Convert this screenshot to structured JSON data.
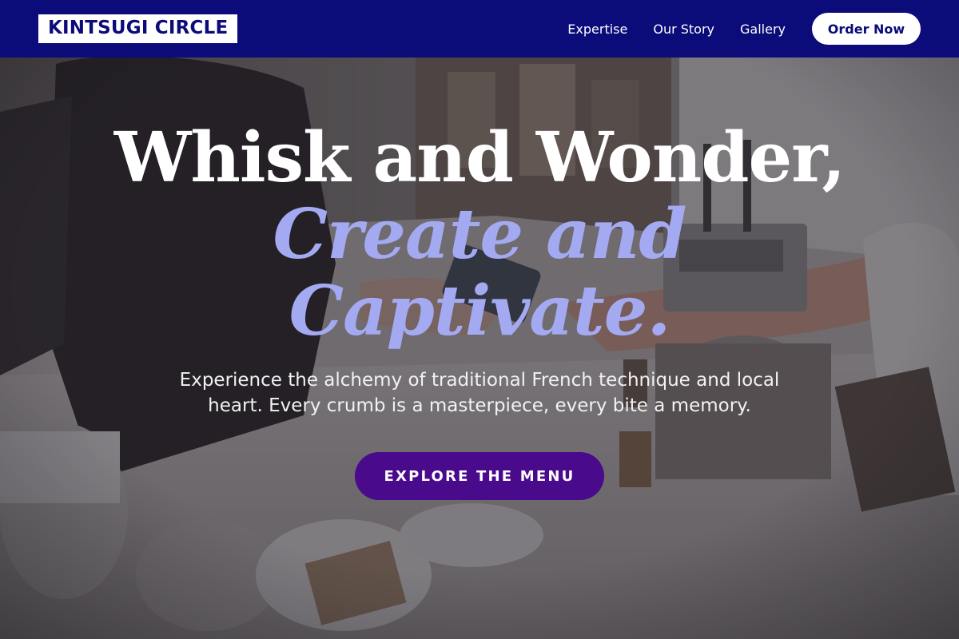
{
  "navbar": {
    "brand": "KINTSUGI CIRCLE",
    "links": [
      "Expertise",
      "Our Story",
      "Gallery"
    ],
    "order_button": "Order Now"
  },
  "hero": {
    "headline_line1": "Whisk and Wonder,",
    "headline_accent": "Create and Captivate.",
    "subtext": "Experience the alchemy of traditional French technique and local heart. Every crumb is a masterpiece, every bite a memory.",
    "cta_label": "EXPLORE THE MENU"
  },
  "colors": {
    "navbar_bg": "#0b0b7a",
    "accent_text": "#a3aaf2",
    "cta_bg": "#4a0a8c"
  }
}
